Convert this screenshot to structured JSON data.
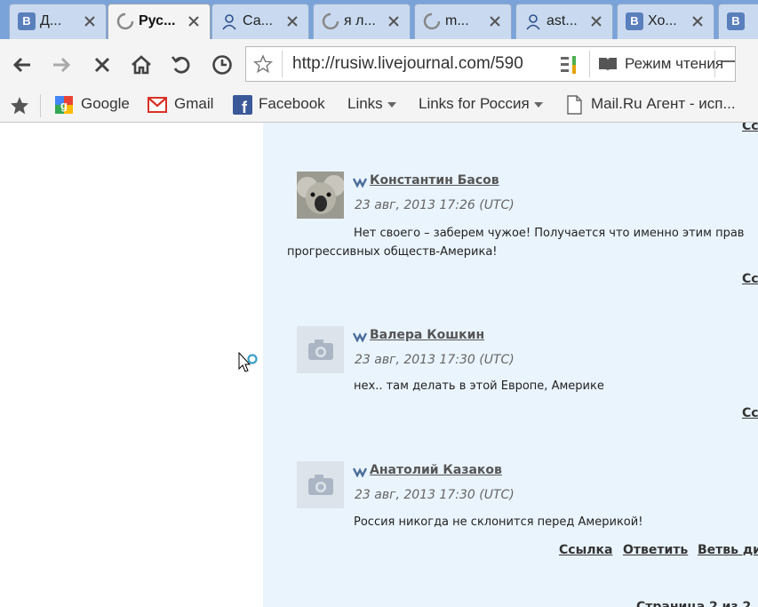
{
  "browser": {
    "tabs": [
      {
        "label": "Д...",
        "icon": "vk-icon",
        "close": "close-icon"
      },
      {
        "label": "Рус...",
        "icon": "loading-spinner-icon",
        "close": "close-icon",
        "active": true
      },
      {
        "label": "Са...",
        "icon": "user-silhouette-icon",
        "close": "close-icon"
      },
      {
        "label": "я л...",
        "icon": "loading-spinner-icon",
        "close": "close-icon"
      },
      {
        "label": "m...",
        "icon": "loading-spinner-icon",
        "close": "close-icon"
      },
      {
        "label": "ast...",
        "icon": "user-silhouette-icon",
        "close": "close-icon"
      },
      {
        "label": "Хо...",
        "icon": "vk-icon",
        "close": "close-icon"
      },
      {
        "label": "",
        "icon": "vk-icon"
      }
    ],
    "toolbar": {
      "url": "http://rusiw.livejournal.com/590",
      "reader_label": "Режим чтения"
    },
    "bookmarks": [
      {
        "label": "Google",
        "icon": "google-icon"
      },
      {
        "label": "Gmail",
        "icon": "gmail-icon"
      },
      {
        "label": "Facebook",
        "icon": "facebook-icon"
      },
      {
        "label": "Links",
        "dropdown": true
      },
      {
        "label": "Links for Россия",
        "dropdown": true
      },
      {
        "label": "Mail.Ru Агент - исп...",
        "icon": "page-icon"
      }
    ]
  },
  "page": {
    "top_link": "Ссылка",
    "comments": [
      {
        "author": "Константин Басов",
        "date": "23 авг, 2013 17:26 (UTC)",
        "text_line1": "Нет своего – заберем чужое! Получается что именно этим прав",
        "text_line2": "прогрессивных обществ-Америка!",
        "link": "Ссылка",
        "userpic": "koala-photo"
      },
      {
        "author": "Валера Кошкин",
        "date": "23 авг, 2013 17:30 (UTC)",
        "text_line1": "нех.. там делать в этой Европе, Америке",
        "link": "Ссылка",
        "userpic": "camera-placeholder-icon"
      },
      {
        "author": "Анатолий Казаков",
        "date": "23 авг, 2013 17:30 (UTC)",
        "text_line1": "Россия никогда не склонится перед Америкой!",
        "actions": [
          "Ссылка",
          "Ответить",
          "Ветвь ди"
        ],
        "userpic": "camera-placeholder-icon"
      }
    ],
    "pagination": "Страница 2 из 2"
  }
}
